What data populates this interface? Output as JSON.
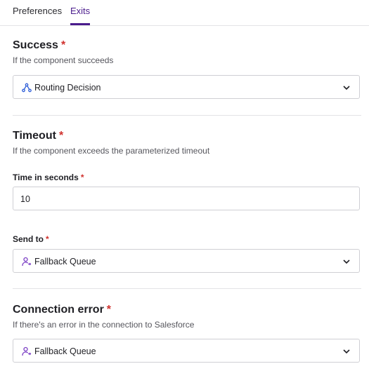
{
  "tabs": [
    {
      "label": "Preferences"
    },
    {
      "label": "Exits"
    }
  ],
  "success": {
    "title": "Success",
    "required_mark": "*",
    "description": "If the component succeeds",
    "selected": "Routing Decision",
    "icon": "routing-decision-icon"
  },
  "timeout": {
    "title": "Timeout",
    "required_mark": "*",
    "description": "If the component exceeds the parameterized timeout",
    "seconds_label": "Time in seconds",
    "seconds_value": "10",
    "send_to_label": "Send to",
    "send_to_selected": "Fallback Queue",
    "icon": "fallback-queue-icon"
  },
  "connection_error": {
    "title": "Connection error",
    "required_mark": "*",
    "description": "If there's an error in the connection to Salesforce",
    "selected": "Fallback Queue",
    "icon": "fallback-queue-icon"
  },
  "colors": {
    "accent": "#4a1b8c",
    "required": "#d0312d",
    "icon_blue": "#2f5fd8",
    "icon_purple": "#7b3fc4"
  }
}
